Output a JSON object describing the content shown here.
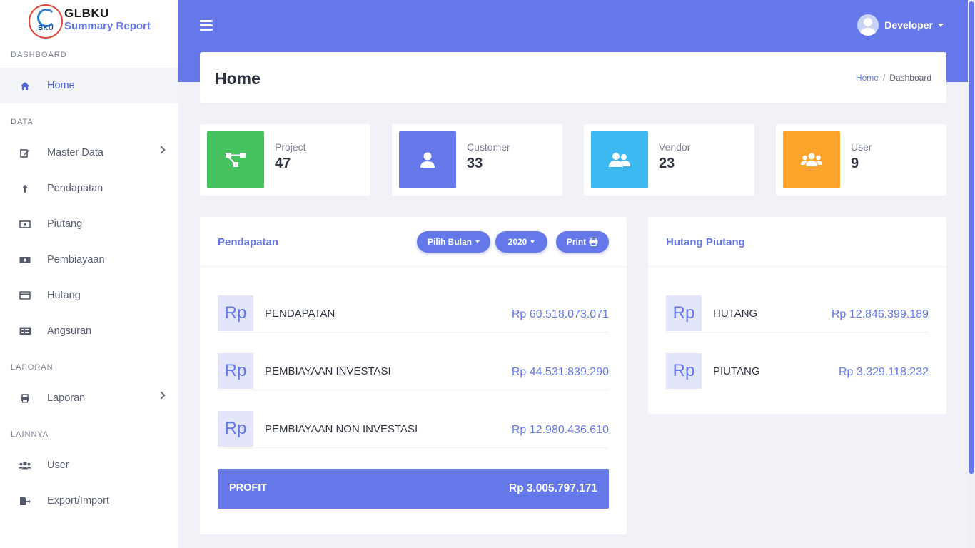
{
  "brand": {
    "title": "GLBKU",
    "subtitle": "Summary Report",
    "logo_text": "BKU"
  },
  "sidebar": {
    "sections": [
      "DASHBOARD",
      "DATA",
      "LAPORAN",
      "LAINNYA"
    ],
    "items": [
      {
        "label": "Home",
        "icon": "home-icon"
      },
      {
        "label": "Master Data",
        "icon": "edit-icon"
      },
      {
        "label": "Pendapatan",
        "icon": "arrow-up-icon"
      },
      {
        "label": "Piutang",
        "icon": "money-bill-icon"
      },
      {
        "label": "Pembiayaan",
        "icon": "money-bill-wave-icon"
      },
      {
        "label": "Hutang",
        "icon": "credit-card-icon"
      },
      {
        "label": "Angsuran",
        "icon": "list-card-icon"
      },
      {
        "label": "Laporan",
        "icon": "printer-icon"
      },
      {
        "label": "User",
        "icon": "users-icon"
      },
      {
        "label": "Export/Import",
        "icon": "file-export-icon"
      }
    ]
  },
  "header": {
    "user_name": "Developer"
  },
  "page": {
    "title": "Home",
    "breadcrumb": [
      "Home",
      "Dashboard"
    ],
    "breadcrumb_sep": "/"
  },
  "stats": [
    {
      "label": "Project",
      "value": "47",
      "color": "#46c35f",
      "icon": "project-diagram-icon"
    },
    {
      "label": "Customer",
      "value": "33",
      "color": "#6578ea",
      "icon": "user-icon"
    },
    {
      "label": "Vendor",
      "value": "23",
      "color": "#3db9f2",
      "icon": "user-friends-icon"
    },
    {
      "label": "User",
      "value": "9",
      "color": "#ffa42a",
      "icon": "users-icon"
    }
  ],
  "pendapatan": {
    "title": "Pendapatan",
    "month_button": "Pilih Bulan",
    "year_button": "2020",
    "print_button": "Print",
    "rows": [
      {
        "icon_text": "Rp",
        "label": "PENDAPATAN",
        "amount": "Rp 60.518.073.071"
      },
      {
        "icon_text": "Rp",
        "label": "PEMBIAYAAN INVESTASI",
        "amount": "Rp 44.531.839.290"
      },
      {
        "icon_text": "Rp",
        "label": "PEMBIAYAAN NON INVESTASI",
        "amount": "Rp 12.980.436.610"
      }
    ],
    "profit": {
      "label": "PROFIT",
      "amount": "Rp 3.005.797.171"
    }
  },
  "hutang_piutang": {
    "title": "Hutang Piutang",
    "rows": [
      {
        "icon_text": "Rp",
        "label": "HUTANG",
        "amount": "Rp 12.846.399.189"
      },
      {
        "icon_text": "Rp",
        "label": "PIUTANG",
        "amount": "Rp 3.329.118.232"
      }
    ]
  },
  "colors": {
    "accent": "#6578ea",
    "background": "#f0f2f8"
  }
}
